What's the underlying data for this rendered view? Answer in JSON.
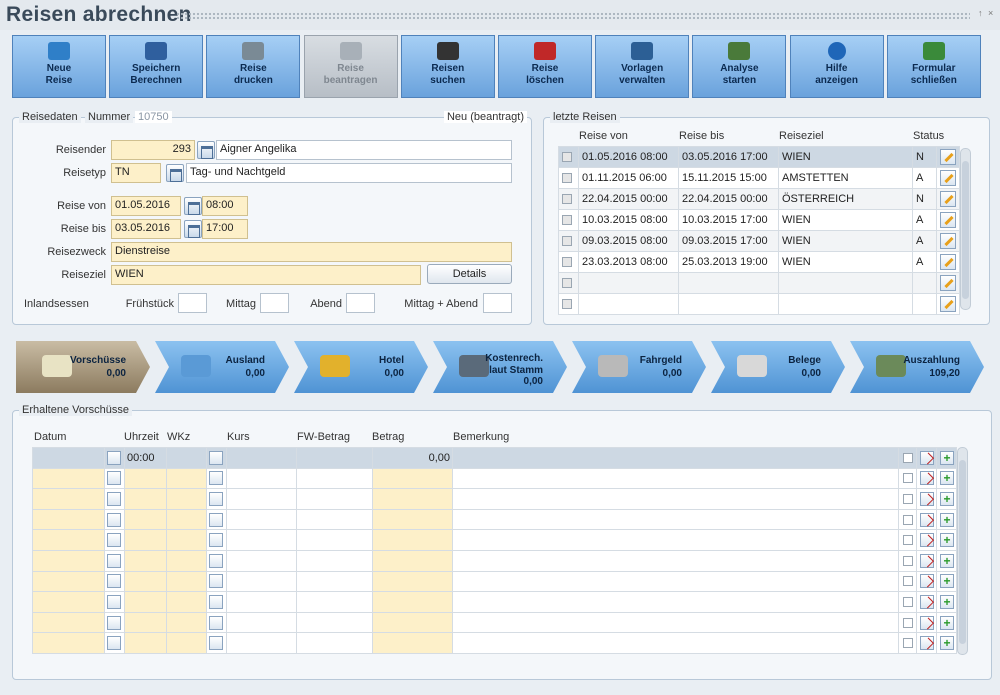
{
  "window": {
    "title": "Reisen abrechnen",
    "controls": [
      "↑",
      "×"
    ]
  },
  "toolbar": [
    {
      "line1": "Neue",
      "line2": "Reise",
      "icon": "new-trip-icon",
      "disabled": false
    },
    {
      "line1": "Speichern",
      "line2": "Berechnen",
      "icon": "save-icon",
      "disabled": false
    },
    {
      "line1": "Reise",
      "line2": "drucken",
      "icon": "printer-icon",
      "disabled": false
    },
    {
      "line1": "Reise",
      "line2": "beantragen",
      "icon": "submit-icon",
      "disabled": true
    },
    {
      "line1": "Reisen",
      "line2": "suchen",
      "icon": "binoculars-icon",
      "disabled": false
    },
    {
      "line1": "Reise",
      "line2": "löschen",
      "icon": "delete-trip-icon",
      "disabled": false
    },
    {
      "line1": "Vorlagen",
      "line2": "verwalten",
      "icon": "templates-icon",
      "disabled": false
    },
    {
      "line1": "Analyse",
      "line2": "starten",
      "icon": "analysis-icon",
      "disabled": false
    },
    {
      "line1": "Hilfe",
      "line2": "anzeigen",
      "icon": "help-icon",
      "disabled": false
    },
    {
      "line1": "Formular",
      "line2": "schließen",
      "icon": "exit-icon",
      "disabled": false
    }
  ],
  "reisedaten": {
    "legend": "Reisedaten",
    "nummer_label": "Nummer",
    "nummer_value": "10750",
    "status": "Neu (beantragt)",
    "reisender_label": "Reisender",
    "reisender_id": "293",
    "reisender_name": "Aigner Angelika",
    "reisetyp_label": "Reisetyp",
    "reisetyp_code": "TN",
    "reisetyp_name": "Tag- und Nachtgeld",
    "von_label": "Reise von",
    "von_date": "01.05.2016",
    "von_time": "08:00",
    "bis_label": "Reise bis",
    "bis_date": "03.05.2016",
    "bis_time": "17:00",
    "zweck_label": "Reisezweck",
    "zweck_value": "Dienstreise",
    "ziel_label": "Reiseziel",
    "ziel_value": "WIEN",
    "details_button": "Details",
    "inland_label": "Inlandsessen",
    "fruehstueck_label": "Frühstück",
    "mittag_label": "Mittag",
    "abend_label": "Abend",
    "mittag_abend_label": "Mittag + Abend"
  },
  "letzte_reisen": {
    "legend": "letzte Reisen",
    "headers": [
      "Reise von",
      "Reise bis",
      "Reiseziel",
      "Status"
    ],
    "rows": [
      {
        "von": "01.05.2016 08:00",
        "bis": "03.05.2016 17:00",
        "ziel": "WIEN",
        "status": "N"
      },
      {
        "von": "01.11.2015 06:00",
        "bis": "15.11.2015 15:00",
        "ziel": "AMSTETTEN",
        "status": "A"
      },
      {
        "von": "22.04.2015 00:00",
        "bis": "22.04.2015 00:00",
        "ziel": "ÖSTERREICH",
        "status": "N"
      },
      {
        "von": "10.03.2015 08:00",
        "bis": "10.03.2015 17:00",
        "ziel": "WIEN",
        "status": "A"
      },
      {
        "von": "09.03.2015 08:00",
        "bis": "09.03.2015 17:00",
        "ziel": "WIEN",
        "status": "A"
      },
      {
        "von": "23.03.2013 08:00",
        "bis": "25.03.2013 19:00",
        "ziel": "WIEN",
        "status": "A"
      },
      {
        "von": "",
        "bis": "",
        "ziel": "",
        "status": ""
      },
      {
        "von": "",
        "bis": "",
        "ziel": "",
        "status": ""
      }
    ]
  },
  "steps": [
    {
      "name": "Vorschüsse",
      "value": "0,00",
      "icon": "money-icon"
    },
    {
      "name": "Ausland",
      "value": "0,00",
      "icon": "globe-icon"
    },
    {
      "name": "Hotel",
      "value": "0,00",
      "icon": "coins-icon"
    },
    {
      "name": "Kostenrech.",
      "name2": "laut Stamm",
      "value": "0,00",
      "icon": "person-icon"
    },
    {
      "name": "Fahrgeld",
      "value": "0,00",
      "icon": "car-icon"
    },
    {
      "name": "Belege",
      "value": "0,00",
      "icon": "receipt-icon"
    },
    {
      "name": "Auszahlung",
      "value": "109,20",
      "icon": "cash-register-icon"
    }
  ],
  "vorschuesse": {
    "legend": "Erhaltene Vorschüsse",
    "headers": [
      "Datum",
      "Uhrzeit",
      "WKz",
      "Kurs",
      "FW-Betrag",
      "Betrag",
      "Bemerkung"
    ],
    "first_row": {
      "uhrzeit": "00:00",
      "betrag": "0,00"
    },
    "row_count": 10
  }
}
